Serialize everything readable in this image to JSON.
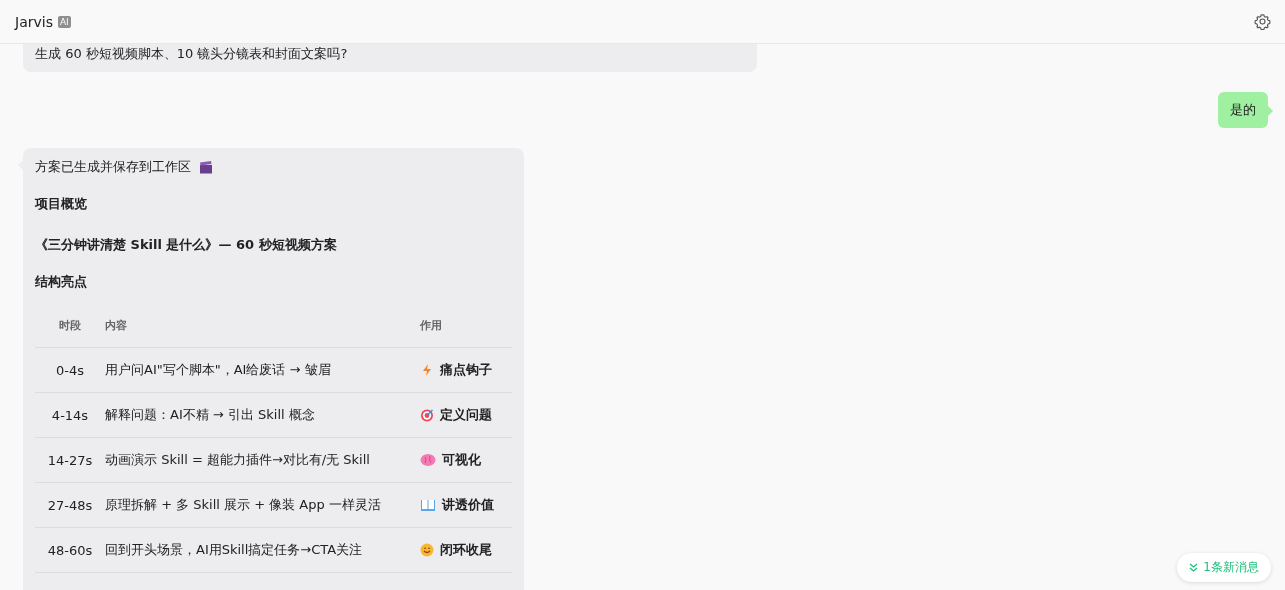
{
  "header": {
    "title": "Jarvis",
    "badge": "AI"
  },
  "messages": [
    {
      "kind": "bot",
      "text": "生成 60 秒短视频脚本、10 镜头分镜表和封面文案吗?"
    },
    {
      "kind": "user",
      "text": "是的"
    },
    {
      "kind": "plan",
      "intro": "方案已生成并保存到工作区",
      "section": "项目概览",
      "title": "《三分钟讲清楚 Skill 是什么》— 60 秒短视频方案",
      "subsection": "结构亮点",
      "table": {
        "columns": [
          "时段",
          "内容",
          "作用"
        ],
        "rows": [
          {
            "time": "0-4s",
            "content": "用户问AI\"写个脚本\"，AI给废话 → 皱眉",
            "role": "痛点钩子"
          },
          {
            "time": "4-14s",
            "content": "解释问题：AI不精 → 引出 Skill 概念",
            "role": "定义问题"
          },
          {
            "time": "14-27s",
            "content": "动画演示 Skill = 超能力插件→对比有/无 Skill",
            "role": "可视化"
          },
          {
            "time": "27-48s",
            "content": "原理拆解 + 多 Skill 展示 + 像装 App 一样灵活",
            "role": "讲透价值"
          },
          {
            "time": "48-60s",
            "content": "回到开头场景，AI用Skill搞定任务→CTA关注",
            "role": "闭环收尾"
          }
        ]
      }
    }
  ],
  "new_messages": {
    "label": "1条新消息"
  }
}
